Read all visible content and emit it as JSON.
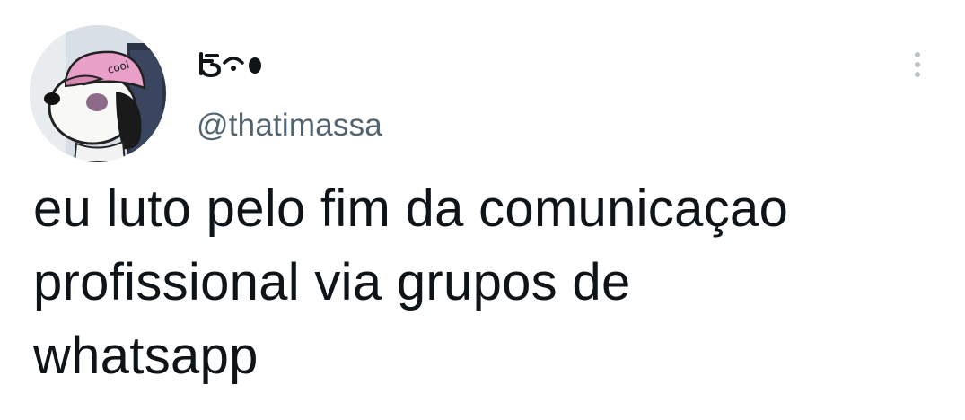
{
  "tweet": {
    "handle": "@thatimassa",
    "text": "eu luto pelo fim da comunicaçao\nprofissional via grupos de\nwhatsapp",
    "display_name_icons": [
      "hourglass-like-glyph",
      "eye-dot-icon",
      "black-ellipse-icon"
    ],
    "avatar_icon": "snoopy-avatar",
    "avatar_cap_text": "cool",
    "menu_icon": "more-vertical-icon"
  },
  "colors": {
    "text": "#0f1419",
    "secondary_text": "#536471",
    "menu_dots": "#b8c1ca",
    "cap": "#e8a0c8"
  }
}
